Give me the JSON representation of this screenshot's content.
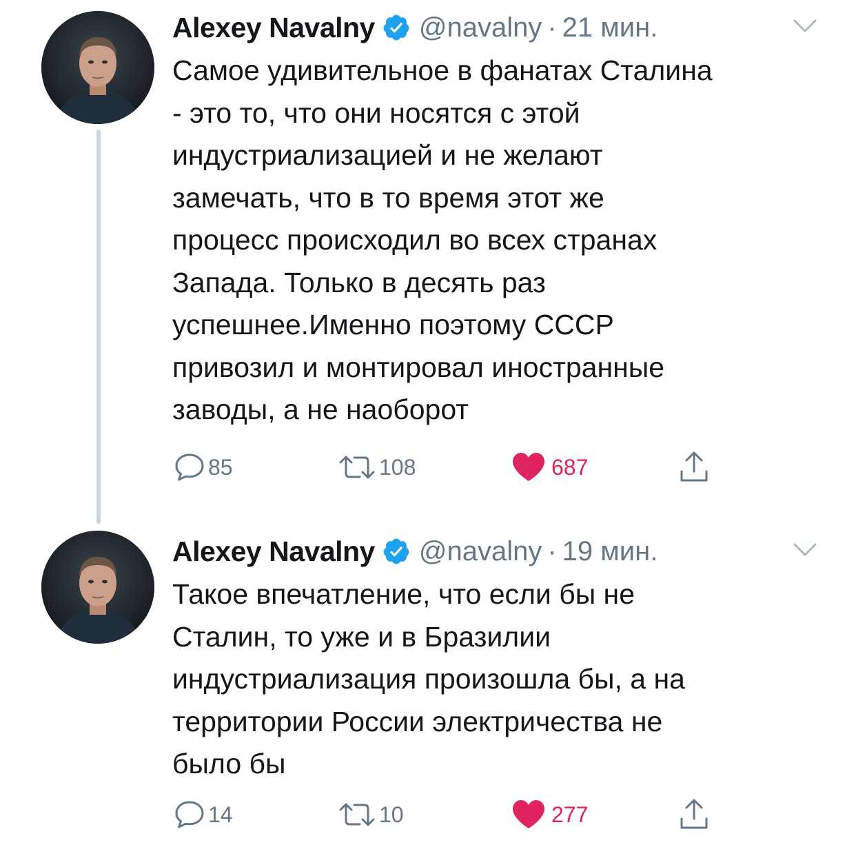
{
  "tweets": [
    {
      "author_name": "Alexey Navalny",
      "handle": "@navalny",
      "separator": "·",
      "time": "21 мин.",
      "text": "Самое удивительное в фанатах Сталина\n- это то, что они носятся с этой\nиндустриализацией и не желают\nзамечать, что в то время этот же\nпроцесс происходил во всех странах\nЗапада. Только в десять раз\nуспешнее.Именно поэтому СССР\nпривозил и монтировал иностранные\nзаводы, а не наоборот",
      "replies": "85",
      "retweets": "108",
      "likes": "687",
      "liked": true
    },
    {
      "author_name": "Alexey Navalny",
      "handle": "@navalny",
      "separator": "·",
      "time": "19 мин.",
      "text": "Такое впечатление, что если бы не\nСталин, то уже и в Бразилии\nиндустриализация произошла бы, а на\nтерритории России электричества не\nбыло бы",
      "replies": "14",
      "retweets": "10",
      "likes": "277",
      "liked": true
    }
  ],
  "icons": {
    "verified": "verified-badge-icon",
    "menu": "chevron-down-icon",
    "reply": "speech-bubble-icon",
    "retweet": "retweet-arrows-icon",
    "like": "heart-icon",
    "share": "share-upload-icon"
  },
  "colors": {
    "text": "#14171a",
    "secondary": "#657786",
    "verified": "#1da1f2",
    "like": "#e0245e",
    "thread_line": "#ccd6dd"
  }
}
